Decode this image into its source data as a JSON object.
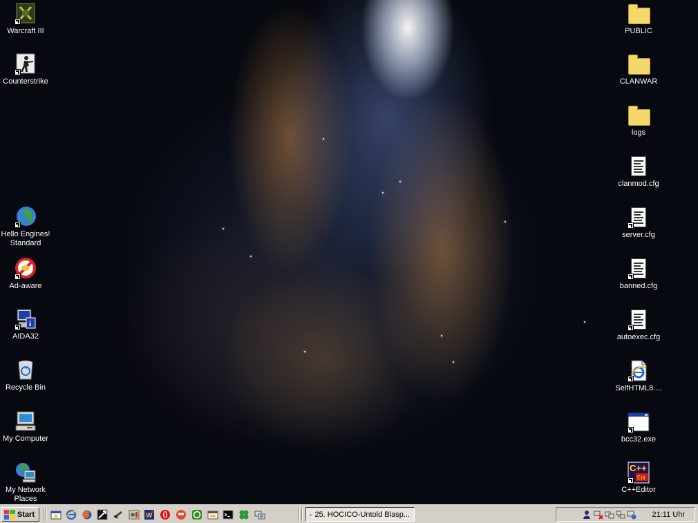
{
  "desktop": {
    "left_icons": [
      {
        "label": "Warcraft III",
        "icon": "warcraft-icon"
      },
      {
        "label": "Counterstrike",
        "icon": "counterstrike-icon"
      },
      {
        "label": "Hello Engines! Standard",
        "icon": "globe-icon"
      },
      {
        "label": "Ad-aware",
        "icon": "ad-aware-icon"
      },
      {
        "label": "AIDA32",
        "icon": "aida32-icon"
      },
      {
        "label": "Recycle Bin",
        "icon": "recycle-bin-icon"
      },
      {
        "label": "My Computer",
        "icon": "my-computer-icon"
      },
      {
        "label": "My Network Places",
        "icon": "network-places-icon"
      }
    ],
    "right_icons": [
      {
        "label": "PUBLIC",
        "icon": "folder-icon"
      },
      {
        "label": "CLANWAR",
        "icon": "folder-icon"
      },
      {
        "label": "logs",
        "icon": "folder-icon"
      },
      {
        "label": "clanmod.cfg",
        "icon": "document-icon"
      },
      {
        "label": "server.cfg",
        "icon": "document-icon"
      },
      {
        "label": "banned.cfg",
        "icon": "document-icon"
      },
      {
        "label": "autoexec.cfg",
        "icon": "document-icon"
      },
      {
        "label": "SelfHTML8....",
        "icon": "ie-document-icon"
      },
      {
        "label": "bcc32.exe",
        "icon": "console-window-icon"
      },
      {
        "label": "C++Editor",
        "icon": "cpp-editor-icon"
      }
    ]
  },
  "taskbar": {
    "start_label": "Start",
    "task_label": "25. HOCICO-Untold Blasp...",
    "clock": "21:11 Uhr"
  },
  "colors": {
    "taskbar_bg": "#d4d0c8",
    "desktop_bg": "#070910"
  }
}
